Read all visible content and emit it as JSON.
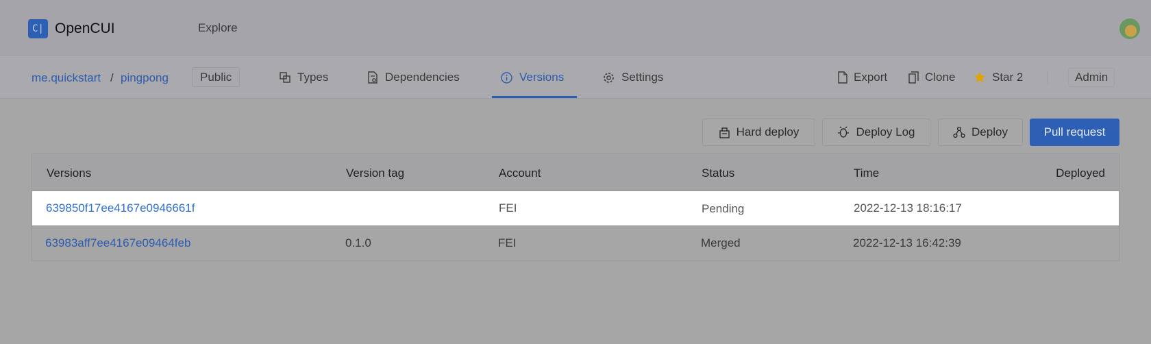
{
  "app": {
    "logo_glyph": "C|",
    "name": "OpenCUI",
    "explore": "Explore"
  },
  "breadcrumb": {
    "org": "me.quickstart",
    "separator": "/",
    "project": "pingpong",
    "visibility": "Public"
  },
  "tabs": [
    {
      "label": "Types",
      "icon": "types-icon"
    },
    {
      "label": "Dependencies",
      "icon": "dependencies-icon"
    },
    {
      "label": "Versions",
      "icon": "info-icon",
      "active": true
    },
    {
      "label": "Settings",
      "icon": "gear-icon"
    }
  ],
  "actions": {
    "export": "Export",
    "clone": "Clone",
    "star": "Star 2",
    "admin": "Admin"
  },
  "buttons": {
    "hard_deploy": "Hard deploy",
    "deploy_log": "Deploy Log",
    "deploy": "Deploy",
    "pull_request": "Pull request"
  },
  "table": {
    "headers": [
      "Versions",
      "Version tag",
      "Account",
      "Status",
      "Time",
      "Deployed"
    ],
    "rows": [
      {
        "version": "639850f17ee4167e0946661f",
        "tag": "",
        "account": "FEI",
        "status": "Pending",
        "time": "2022-12-13 18:16:17",
        "deployed": ""
      },
      {
        "version": "63983aff7ee4167e09464feb",
        "tag": "0.1.0",
        "account": "FEI",
        "status": "Merged",
        "time": "2022-12-13 16:42:39",
        "deployed": ""
      }
    ]
  },
  "colors": {
    "accent": "#2d5fb5",
    "link": "#2c5bb0",
    "star": "#e0a300",
    "overlay_bg": "#a6a6a7"
  }
}
